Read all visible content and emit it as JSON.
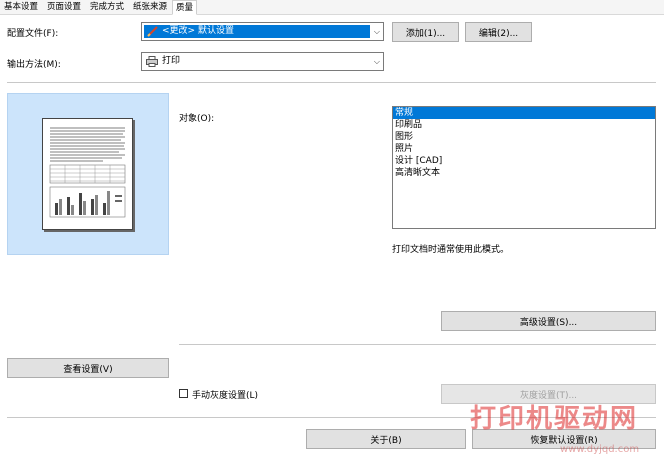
{
  "tabs": [
    {
      "label": "基本设置"
    },
    {
      "label": "页面设置"
    },
    {
      "label": "完成方式"
    },
    {
      "label": "纸张来源"
    },
    {
      "label": "质量"
    }
  ],
  "profile": {
    "label": "配置文件(F):",
    "value": "<更改> 默认设置",
    "add_button": "添加(1)...",
    "edit_button": "编辑(2)..."
  },
  "output": {
    "label": "输出方法(M):",
    "value": "打印"
  },
  "objective": {
    "label": "对象(O):",
    "items": [
      {
        "label": "常规",
        "selected": true
      },
      {
        "label": "印刷品"
      },
      {
        "label": "图形"
      },
      {
        "label": "照片"
      },
      {
        "label": "设计 [CAD]"
      },
      {
        "label": "高清晰文本"
      }
    ],
    "description": "打印文档时通常使用此模式。"
  },
  "buttons": {
    "advanced": "高级设置(S)...",
    "view_settings": "查看设置(V)",
    "gray_settings": "灰度设置(T)...",
    "about": "关于(B)",
    "restore": "恢复默认设置(R)"
  },
  "manual_gray": {
    "label": "手动灰度设置(L)",
    "checked": false
  },
  "watermark": {
    "text": "打印机驱动网",
    "url": "www.dyjqd.com"
  },
  "colors": {
    "selection": "#0078d7",
    "preview_bg": "#cce4fb"
  }
}
